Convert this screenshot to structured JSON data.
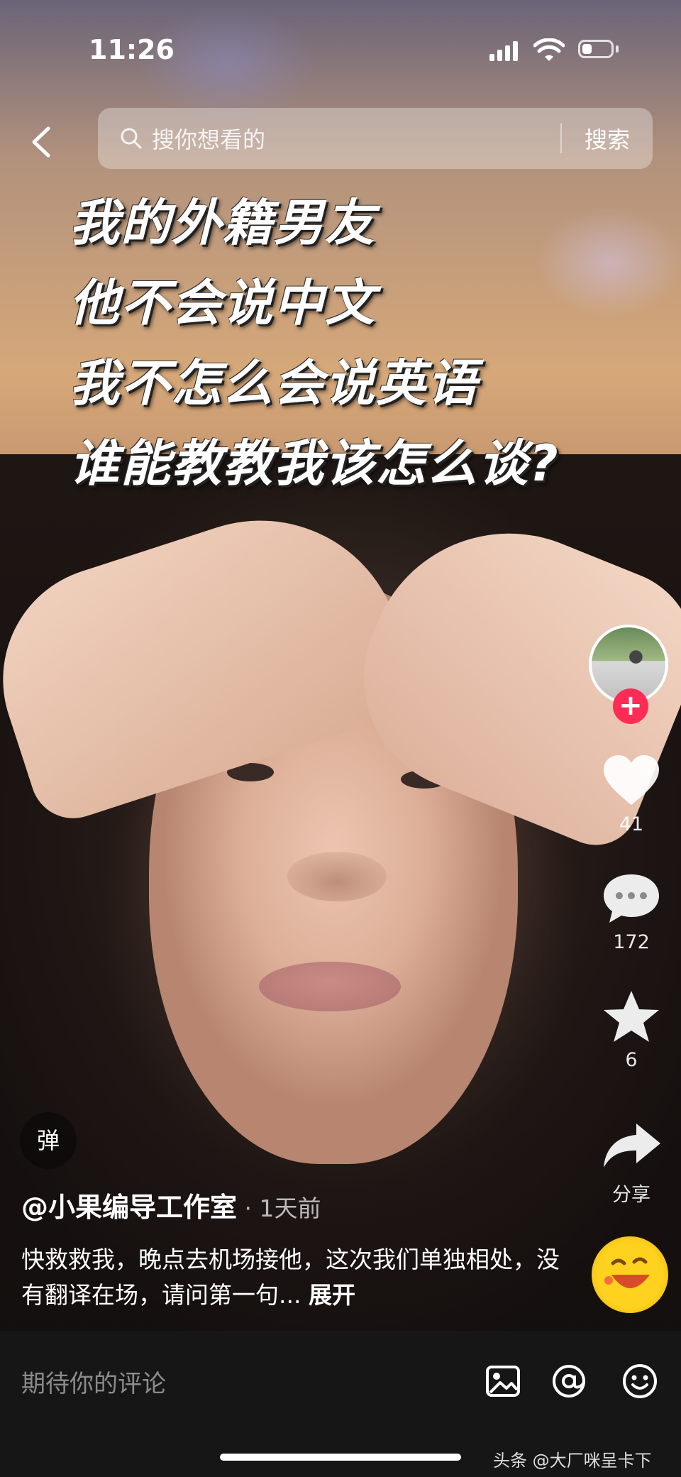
{
  "status_bar": {
    "time": "11:26"
  },
  "search": {
    "placeholder": "搜你想看的",
    "button": "搜索"
  },
  "caption": {
    "lines": [
      "我的外籍男友",
      "他不会说中文",
      "我不怎么会说英语",
      "谁能教教我该怎么谈?"
    ]
  },
  "rail": {
    "follow": "+",
    "likes": "41",
    "comments": "172",
    "favorites": "6",
    "share": "分享"
  },
  "danmu": "弹",
  "author": {
    "name": "@小果编导工作室",
    "time": " · 1天前"
  },
  "description": {
    "text": "快救救我，晚点去机场接他，这次我们单独相处，没有翻译在场，请问第一句...",
    "expand": "展开"
  },
  "bottom": {
    "comment_placeholder": "期待你的评论"
  },
  "watermark": "头条 @大厂咪呈卡下"
}
